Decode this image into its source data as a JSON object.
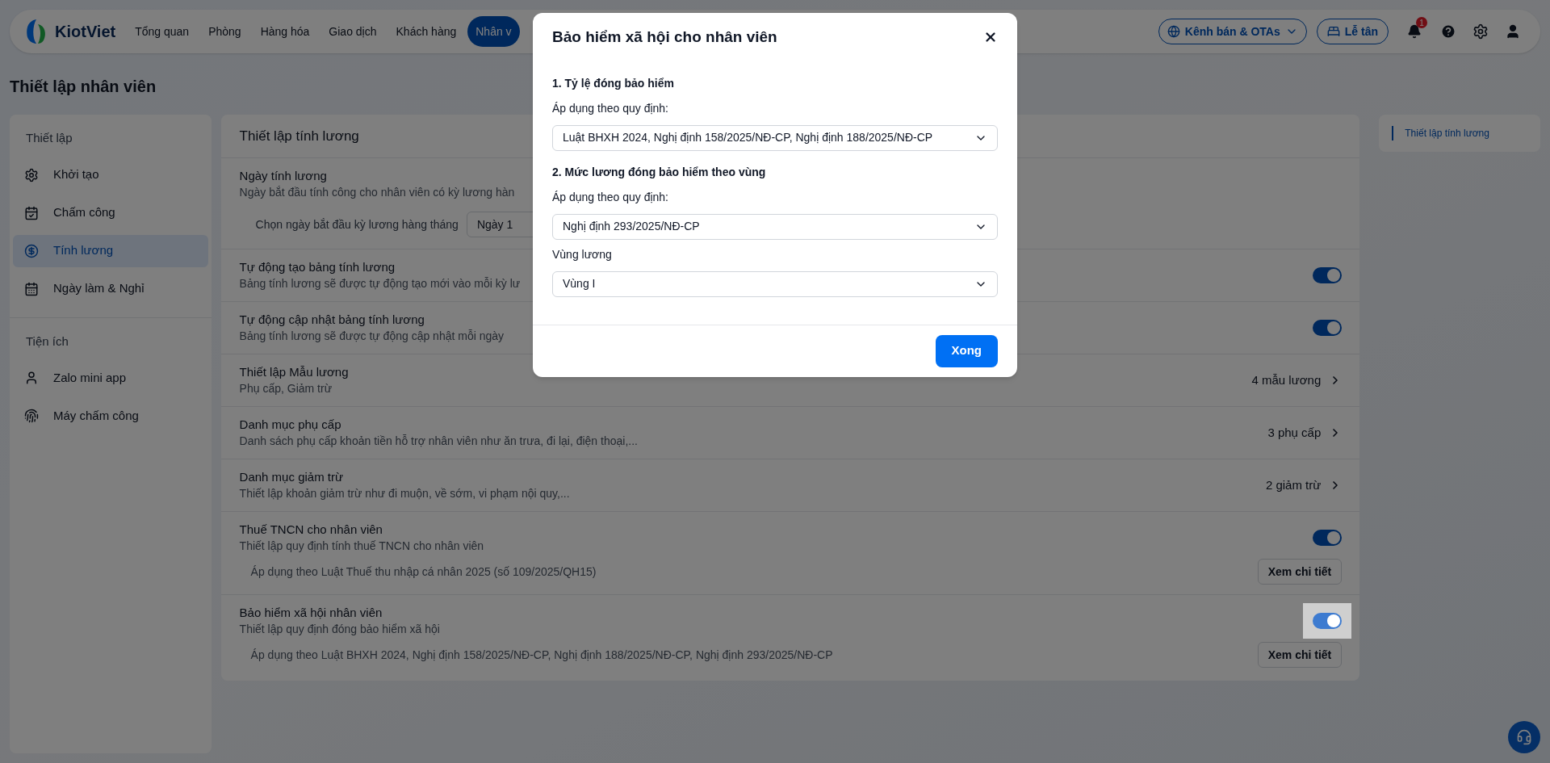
{
  "nav": {
    "logo": "KiotViet",
    "items": [
      {
        "label": "Tổng quan",
        "selected": false
      },
      {
        "label": "Phòng",
        "selected": false
      },
      {
        "label": "Hàng hóa",
        "selected": false
      },
      {
        "label": "Giao dịch",
        "selected": false
      },
      {
        "label": "Khách hàng",
        "selected": false
      },
      {
        "label": "Nhân v",
        "selected": true
      }
    ],
    "channel_button": "Kênh bán & OTAs",
    "reception_button": "Lễ tân",
    "notification_count": "1"
  },
  "page_title": "Thiết lập nhân viên",
  "sidebar": {
    "sections": [
      {
        "title": "Thiết lập",
        "items": [
          {
            "label": "Khởi tạo",
            "selected": false
          },
          {
            "label": "Chấm công",
            "selected": false
          },
          {
            "label": "Tính lương",
            "selected": true
          },
          {
            "label": "Ngày làm & Nghỉ",
            "selected": false
          }
        ]
      },
      {
        "title": "Tiện ích",
        "items": [
          {
            "label": "Zalo mini app",
            "selected": false
          },
          {
            "label": "Máy chấm công",
            "selected": false
          }
        ]
      }
    ]
  },
  "card": {
    "title": "Thiết lập tính lương",
    "rows": [
      {
        "kind": "select",
        "title": "Ngày tính lương",
        "description": "Ngày bắt đầu tính công cho nhân viên có kỳ lương hàn",
        "select_label": "Chọn ngày bắt đầu kỳ lương hàng tháng",
        "select_value": "Ngày 1"
      },
      {
        "kind": "toggle",
        "title": "Tự động tạo bảng tính lương",
        "description": "Bảng tính lương sẽ được tự động tạo mới vào mỗi kỳ lư",
        "on": true,
        "focused": false
      },
      {
        "kind": "toggle",
        "title": "Tự động cập nhật bảng tính lương",
        "description": "Bảng tính lương sẽ được tự động cập nhật mỗi ngày",
        "on": true,
        "focused": false
      },
      {
        "kind": "link",
        "title": "Thiết lập Mẫu lương",
        "description": "Phụ cấp, Giảm trừ",
        "count": "4 mẫu lương"
      },
      {
        "kind": "link",
        "title": "Danh mục phụ cấp",
        "description": "Danh sách phụ cấp khoản tiền hỗ trợ nhân viên như ăn trưa, đi lại, điện thoại,...",
        "count": "3 phụ cấp"
      },
      {
        "kind": "link",
        "title": "Danh mục giảm trừ",
        "description": "Thiết lập khoản giảm trừ như đi muộn, về sớm, vi phạm nội quy,...",
        "count": "2 giảm trừ"
      },
      {
        "kind": "toggle_note",
        "title": "Thuế TNCN cho nhân viên",
        "description": "Thiết lập quy định tính thuế TNCN cho nhân viên",
        "on": true,
        "focused": false,
        "note": "Áp dụng theo Luật Thuế thu nhập cá nhân 2025 (số 109/2025/QH15)",
        "button": "Xem chi tiết"
      },
      {
        "kind": "toggle_note",
        "title": "Bảo hiểm xã hội nhân viên",
        "description": "Thiết lập quy định đóng bảo hiểm xã hội",
        "on": true,
        "focused": true,
        "note": "Áp dụng theo Luật BHXH 2024, Nghị định 158/2025/NĐ-CP, Nghị định 188/2025/NĐ-CP, Nghị định 293/2025/NĐ-CP",
        "button": "Xem chi tiết"
      }
    ]
  },
  "toc": [
    {
      "label": "Thiết lập tính lương",
      "selected": true
    }
  ],
  "modal": {
    "title": "Bảo hiểm xã hội cho nhân viên",
    "items": [
      {
        "kind": "heading",
        "text": "1. Tỷ lệ đóng bảo hiểm"
      },
      {
        "kind": "select",
        "label": "Áp dụng theo quy định:",
        "value": "Luật BHXH 2024, Nghị định 158/2025/NĐ-CP, Nghị định 188/2025/NĐ-CP"
      },
      {
        "kind": "heading",
        "text": "2. Mức lương đóng bảo hiểm theo vùng"
      },
      {
        "kind": "select",
        "label": "Áp dụng theo quy định:",
        "value": "Nghị định 293/2025/NĐ-CP"
      },
      {
        "kind": "select",
        "label": "Vùng lương",
        "value": "Vùng I"
      }
    ],
    "button": "Xong"
  }
}
